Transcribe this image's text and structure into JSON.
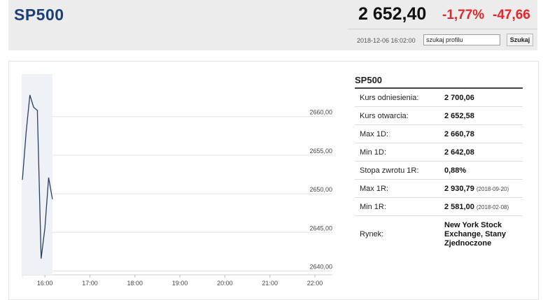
{
  "header": {
    "title": "SP500",
    "price": "2 652,40",
    "change_pct": "-1,77%",
    "change_abs": "-47,66",
    "timestamp": "2018-12-06 16:02:00",
    "search_value": "szukaj profilu",
    "search_button": "Szukaj"
  },
  "info": {
    "title": "SP500",
    "rows": [
      {
        "label": "Kurs odniesienia:",
        "value": "2 700,06",
        "date": ""
      },
      {
        "label": "Kurs otwarcia:",
        "value": "2 652,58",
        "date": ""
      },
      {
        "label": "Max 1D:",
        "value": "2 660,78",
        "date": ""
      },
      {
        "label": "Min 1D:",
        "value": "2 642,08",
        "date": ""
      },
      {
        "label": "Stopa zwrotu 1R:",
        "value": "0,88%",
        "date": ""
      },
      {
        "label": "Max 1R:",
        "value": "2 930,79",
        "date": "(2018-09-20)"
      },
      {
        "label": "Min 1R:",
        "value": "2 581,00",
        "date": "(2018-02-08)"
      },
      {
        "label": "Rynek:",
        "value": "New York Stock Exchange, Stany Zjednoczone",
        "date": ""
      }
    ]
  },
  "chart_data": {
    "type": "line",
    "x_ticks": [
      "16:00",
      "17:00",
      "18:00",
      "19:00",
      "20:00",
      "21:00",
      "22:00"
    ],
    "y_ticks": [
      "2660,00",
      "2655,00",
      "2650,00",
      "2645,00",
      "2640,00"
    ],
    "y_tick_values": [
      2660,
      2655,
      2650,
      2645,
      2640
    ],
    "ylim": [
      2639.5,
      2665.5
    ],
    "xlim": [
      "15:30",
      "22:00"
    ],
    "grid": "horizontal",
    "line_color": "#2d3f5e",
    "series": [
      {
        "x": [
          "15:30",
          "15:35",
          "15:40",
          "15:45",
          "15:50",
          "15:55",
          "16:00",
          "16:05",
          "16:10"
        ],
        "y": [
          2651.8,
          2658.0,
          2662.8,
          2661.2,
          2660.8,
          2641.6,
          2645.6,
          2652.1,
          2649.3
        ]
      }
    ]
  }
}
